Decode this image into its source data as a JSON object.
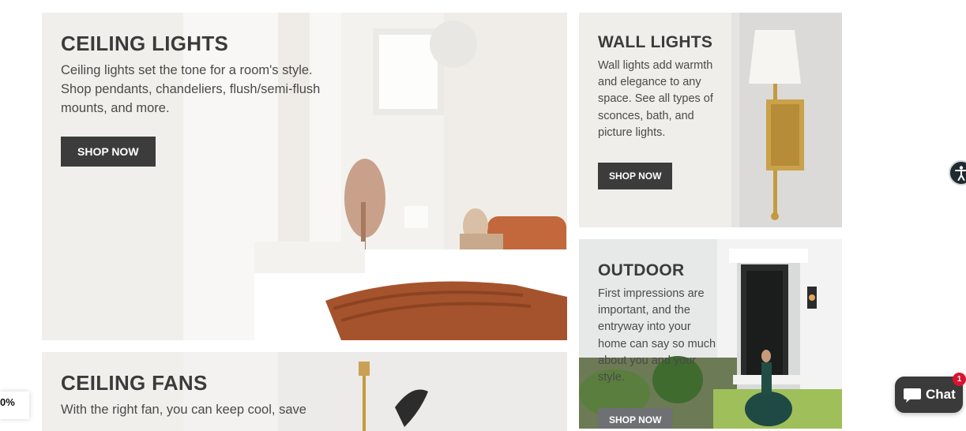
{
  "categories": {
    "ceiling_lights": {
      "title": "CEILING LIGHTS",
      "description": "Ceiling lights set the tone for a room's style. Shop pendants, chandeliers, flush/semi-flush mounts, and more.",
      "button": "SHOP NOW"
    },
    "wall_lights": {
      "title": "WALL LIGHTS",
      "description": "Wall lights add warmth and elegance to any space. See all types of sconces, bath, and picture lights.",
      "button": "SHOP NOW"
    },
    "outdoor": {
      "title": "OUTDOOR",
      "description": "First impressions are important, and the entryway into your home can say so much about you and your style.",
      "button": "SHOP NOW"
    },
    "ceiling_fans": {
      "title": "CEILING FANS",
      "description": "With the right fan, you can keep cool, save"
    }
  },
  "widgets": {
    "chat": {
      "label": "Chat",
      "badge": "1",
      "icon": "chat-bubble-icon"
    },
    "accessibility": {
      "icon": "accessibility-icon"
    },
    "promo_tab": {
      "text": "0%"
    }
  },
  "colors": {
    "card_bg": "#f1efec",
    "button_bg": "#3c3c3c",
    "chat_bg": "#3a3a3a",
    "badge": "#d9132f"
  }
}
